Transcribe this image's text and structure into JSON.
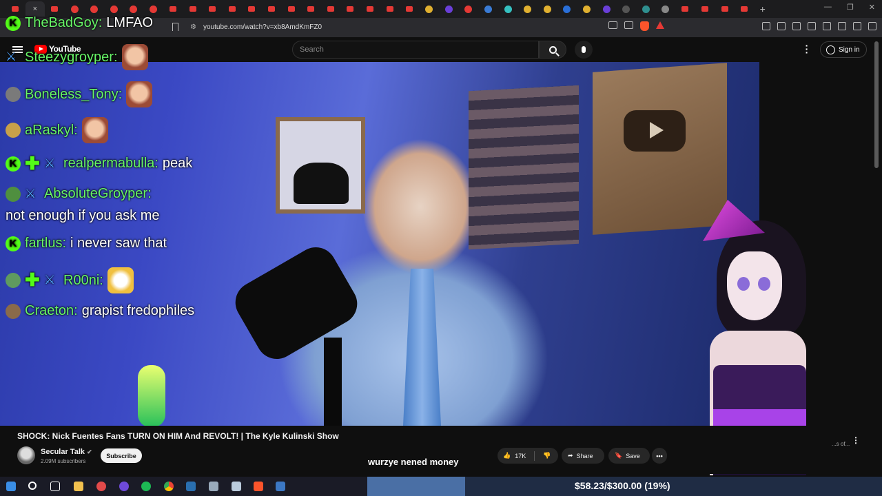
{
  "browser": {
    "url": "youtube.com/watch?v=xb8AmdKmFZ0",
    "close_tab_glyph": "×",
    "new_tab_glyph": "+"
  },
  "youtube": {
    "logo_text": "YouTube",
    "search_placeholder": "Search",
    "sign_in_label": "Sign in"
  },
  "chat": {
    "messages": [
      {
        "user": "TheBadGoy:",
        "text": "LMFAO",
        "badge": "kick-badge"
      },
      {
        "user": "Steezygroyper:",
        "text": "",
        "badge": "avatar"
      },
      {
        "user": "Boneless_Tony:",
        "text": "",
        "badge": "avatar"
      },
      {
        "user": "aRaskyl:",
        "text": "",
        "badge": "avatar"
      },
      {
        "user": "realpermabulla:",
        "text": "peak",
        "badge": "kick-badge"
      },
      {
        "user": "AbsoluteGroyper:",
        "text": "not enough if you ask me",
        "badge": "avatar"
      },
      {
        "user": "fartlus:",
        "text": "i never saw that",
        "badge": "kick-badge"
      },
      {
        "user": "R00ni:",
        "text": "",
        "badge": "avatar"
      },
      {
        "user": "Craeton:",
        "text": "grapist fredophiles",
        "badge": "avatar"
      }
    ]
  },
  "video": {
    "title": "SHOCK: Nick Fuentes Fans TURN ON HIM And REVOLT! | The Kyle Kulinski Show",
    "channel": "Secular Talk",
    "subscribers": "2.09M subscribers",
    "subscribe_label": "Subscribe",
    "likes": "17K",
    "share_label": "Share",
    "save_label": "Save",
    "more_glyph": "•••",
    "caption": "wurzye nened money"
  },
  "sidebar": {
    "snippet": "...s of..."
  },
  "donation_goal": {
    "text": "$58.23/$300.00 (19%)",
    "fraction": 0.19
  },
  "colors": {
    "chat_name": "#67f567",
    "kick_green": "#53fc18",
    "yt_red": "#ff0000"
  }
}
